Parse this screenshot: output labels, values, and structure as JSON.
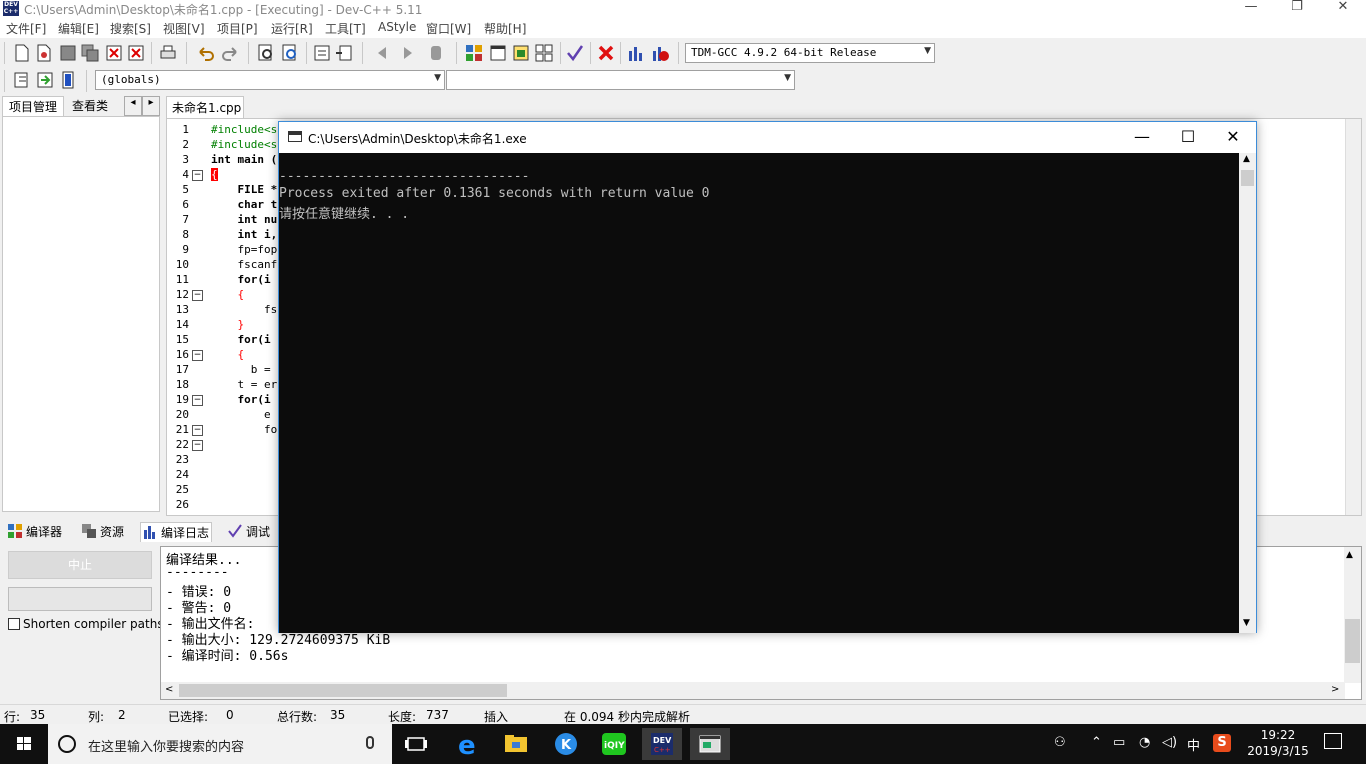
{
  "window": {
    "title": "C:\\Users\\Admin\\Desktop\\未命名1.cpp - [Executing] - Dev-C++ 5.11",
    "minimize": "—",
    "restore": "❐",
    "close": "✕"
  },
  "menu": [
    "文件[F]",
    "编辑[E]",
    "搜索[S]",
    "视图[V]",
    "项目[P]",
    "运行[R]",
    "工具[T]",
    "AStyle",
    "窗口[W]",
    "帮助[H]"
  ],
  "toolbar": {
    "compiler_select": "TDM-GCC 4.9.2 64-bit Release",
    "scope_select": "(globals)",
    "member_select": ""
  },
  "left_panel": {
    "tabs": [
      "项目管理",
      "查看类"
    ],
    "nav_prev": "◂",
    "nav_next": "▸"
  },
  "editor": {
    "file_tab": "未命名1.cpp",
    "line_numbers": [
      "1",
      "2",
      "3",
      "4",
      "5",
      "6",
      "7",
      "8",
      "9",
      "10",
      "11",
      "12",
      "13",
      "14",
      "15",
      "16",
      "17",
      "18",
      "19",
      "20",
      "21",
      "22",
      "23",
      "24",
      "25",
      "26"
    ],
    "lines": [
      "#include<s",
      "#include<s",
      "int main (",
      "{",
      "    FILE *",
      "    char t",
      "    int nu",
      "    int i,",
      "    fp=fop",
      "    fscanf",
      "    for(i",
      "    {",
      "        fs",
      "    }",
      "    for(i",
      "    {",
      "      b =",
      "    t = er",
      "    for(i",
      "        e",
      "        fo",
      "",
      "",
      "",
      "",
      ""
    ]
  },
  "bottom_tabs": [
    "编译器",
    "资源",
    "编译日志",
    "调试"
  ],
  "compile_panel": {
    "abort_button": "中止",
    "shorten_label": "Shorten compiler paths",
    "log": [
      "编译结果...",
      "--------",
      "- 错误: 0",
      "- 警告: 0",
      "- 输出文件名:",
      "- 输出大小: 129.2724609375 KiB",
      "- 编译时间: 0.56s"
    ]
  },
  "status": {
    "row_label": "行:",
    "row_value": "35",
    "col_label": "列:",
    "col_value": "2",
    "sel_label": "已选择:",
    "sel_value": "0",
    "lines_label": "总行数:",
    "lines_value": "35",
    "len_label": "长度:",
    "len_value": "737",
    "mode": "插入",
    "parse_msg": "在 0.094 秒内完成解析"
  },
  "console": {
    "title": "C:\\Users\\Admin\\Desktop\\未命名1.exe",
    "minimize": "—",
    "maximize": "☐",
    "close": "✕",
    "lines": [
      "--------------------------------",
      "Process exited after 0.1361 seconds with return value 0",
      "请按任意键继续. . ."
    ]
  },
  "taskbar": {
    "search_placeholder": "在这里输入你要搜索的内容",
    "ime": "中",
    "time": "19:22",
    "date": "2019/3/15"
  },
  "colors": {
    "console_bg": "#0c0c0c",
    "console_text": "#c0c0c0",
    "taskbar_bg": "#101010",
    "accent_border": "#3c8cd8"
  }
}
